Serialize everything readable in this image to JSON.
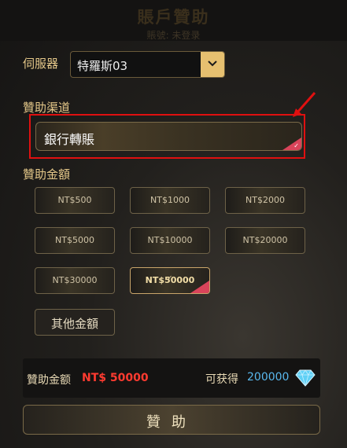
{
  "header": {
    "title": "賬戶贊助",
    "subtitle": "賬號: 未登录"
  },
  "server": {
    "label": "伺服器",
    "value": "特羅斯03"
  },
  "channel": {
    "label": "贊助渠道",
    "value": "銀行轉賬"
  },
  "amount": {
    "label": "贊助金額",
    "options": [
      "NT$500",
      "NT$1000",
      "NT$2000",
      "NT$5000",
      "NT$10000",
      "NT$20000",
      "NT$30000",
      "NT$50000"
    ],
    "selected": "NT$50000",
    "other_label": "其他金額"
  },
  "summary": {
    "amount_label": "贊助金额",
    "amount_value": "NT$ 50000",
    "gain_label": "可获得",
    "gain_value": "200000"
  },
  "donate_button": "贊助",
  "colors": {
    "accent_gold": "#e6c070",
    "highlight_red": "#e01010",
    "amount_red": "#ff3b30",
    "gain_blue": "#59b8ee"
  }
}
